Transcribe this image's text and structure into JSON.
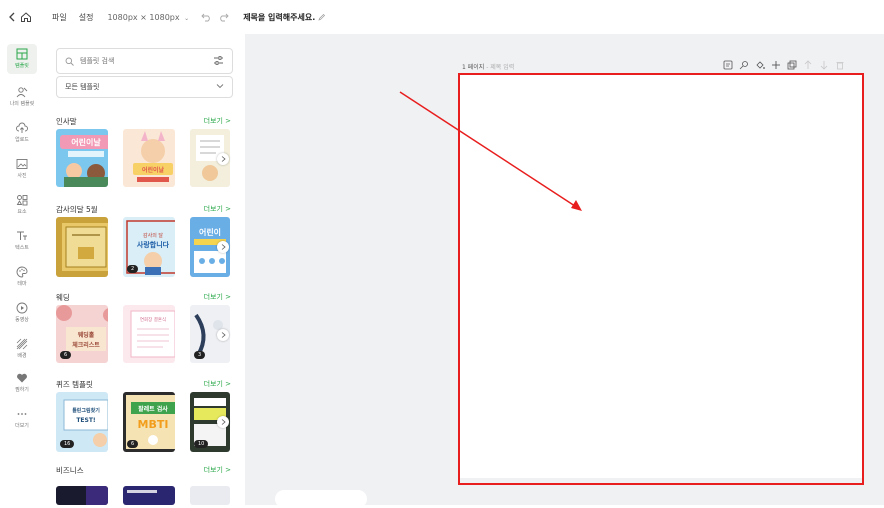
{
  "topbar": {
    "file_label": "파일",
    "settings_label": "설정",
    "canvas_size": "1080px × 1080px",
    "title_placeholder": "제목을 입력해주세요."
  },
  "leftnav": {
    "items": [
      {
        "label": "템플릿",
        "icon": "template-icon"
      },
      {
        "label": "나의 템플릿",
        "icon": "my-template-icon"
      },
      {
        "label": "업로드",
        "icon": "upload-icon"
      },
      {
        "label": "사진",
        "icon": "photo-icon"
      },
      {
        "label": "요소",
        "icon": "elements-icon"
      },
      {
        "label": "텍스트",
        "icon": "text-icon"
      },
      {
        "label": "테마",
        "icon": "theme-icon"
      },
      {
        "label": "동영상",
        "icon": "video-icon"
      },
      {
        "label": "배경",
        "icon": "background-icon"
      },
      {
        "label": "찜하기",
        "icon": "heart-icon"
      },
      {
        "label": "더보기",
        "icon": "more-icon"
      }
    ]
  },
  "panel": {
    "search_placeholder": "템플릿 검색",
    "category_select": "모든 템플릿",
    "more_label": "더보기 >",
    "sections": [
      {
        "title": "인사말",
        "badges": []
      },
      {
        "title": "감사의달 5월",
        "badges": [
          "",
          "2",
          ""
        ]
      },
      {
        "title": "웨딩",
        "badges": [
          "6",
          "",
          "3"
        ]
      },
      {
        "title": "퀴즈 템플릿",
        "badges": [
          "16",
          "6",
          "10"
        ]
      },
      {
        "title": "비즈니스",
        "badges": []
      }
    ]
  },
  "canvas": {
    "page_number": "1 페이지",
    "page_title_placeholder": "- 제목 입력"
  },
  "colors": {
    "accent": "#2ba84a",
    "annotation": "#e81e1e"
  }
}
